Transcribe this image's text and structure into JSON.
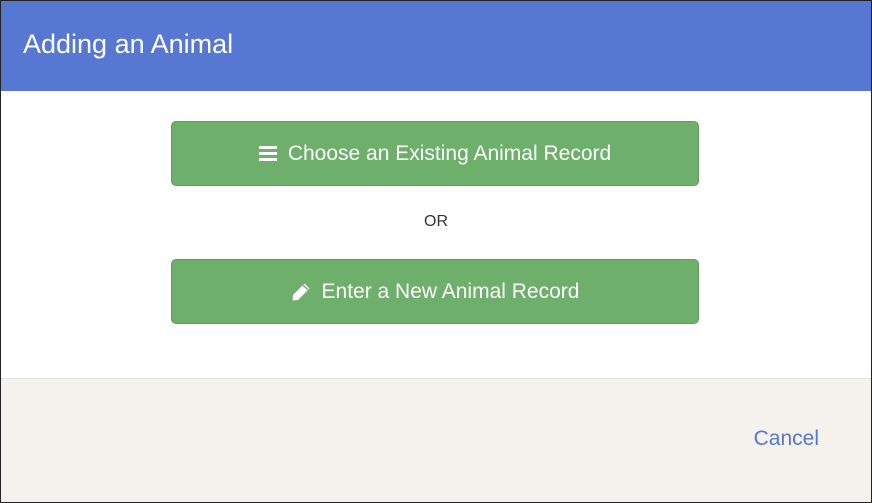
{
  "dialog": {
    "title": "Adding an Animal",
    "choose_existing_label": "Choose an Existing Animal Record",
    "choose_existing_icon": "list-icon",
    "separator": "OR",
    "enter_new_label": "Enter a New Animal Record",
    "enter_new_icon": "pencil-icon",
    "cancel_label": "Cancel"
  },
  "colors": {
    "header": "#5677d2",
    "button": "#6daf6b",
    "footer": "#f5f2ee",
    "link": "#5677d2"
  }
}
